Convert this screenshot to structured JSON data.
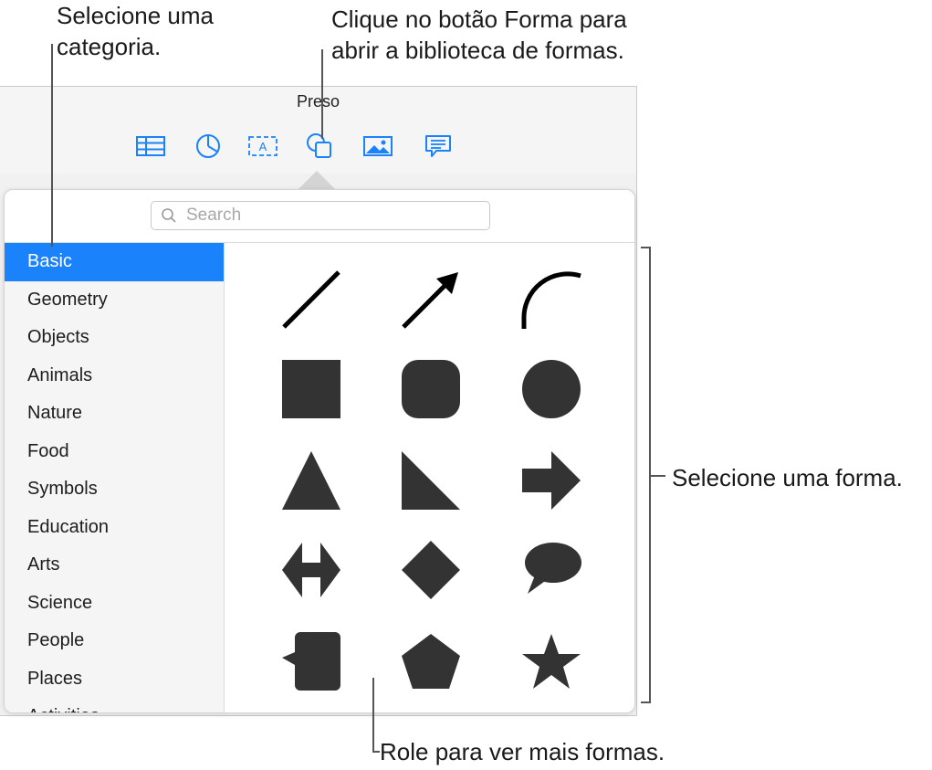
{
  "callouts": {
    "category": [
      "Selecione uma",
      "categoria."
    ],
    "shape_button": [
      "Clique no botão Forma para",
      "abrir a biblioteca de formas."
    ],
    "select_shape": "Selecione uma forma.",
    "scroll": "Role para ver mais formas."
  },
  "window": {
    "title": "Preso",
    "toolbar": [
      {
        "icon": "table-icon"
      },
      {
        "icon": "chart-icon"
      },
      {
        "icon": "text-box-icon"
      },
      {
        "icon": "shape-icon"
      },
      {
        "icon": "media-icon"
      },
      {
        "icon": "comment-icon"
      }
    ]
  },
  "popover": {
    "search": {
      "placeholder": "Search",
      "value": ""
    },
    "categories": [
      "Basic",
      "Geometry",
      "Objects",
      "Animals",
      "Nature",
      "Food",
      "Symbols",
      "Education",
      "Arts",
      "Science",
      "People",
      "Places",
      "Activities"
    ],
    "selected_category": "Basic",
    "shapes": [
      "line",
      "arrow",
      "curve",
      "square",
      "rounded-square",
      "circle",
      "triangle",
      "right-triangle",
      "arrow-right",
      "double-arrow",
      "diamond",
      "speech-bubble",
      "callout-rectangle",
      "pentagon",
      "star"
    ]
  },
  "colors": {
    "accent": "#1a82fb",
    "shape_fill": "#333333",
    "selection": "#1a82fb"
  }
}
